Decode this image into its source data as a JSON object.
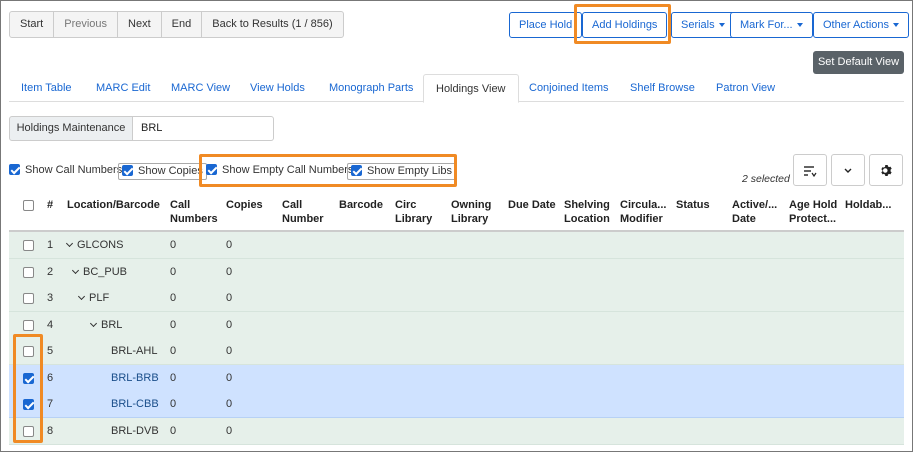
{
  "nav": {
    "start": "Start",
    "previous": "Previous",
    "next": "Next",
    "end": "End",
    "back": "Back to Results (1 / 856)"
  },
  "actions": {
    "place_hold": "Place Hold",
    "add_holdings": "Add Holdings",
    "serials": "Serials",
    "mark_for": "Mark For...",
    "other_actions": "Other Actions",
    "set_default_view": "Set Default View"
  },
  "tabs": [
    {
      "label": "Item Table"
    },
    {
      "label": "MARC Edit"
    },
    {
      "label": "MARC View"
    },
    {
      "label": "View Holds"
    },
    {
      "label": "Monograph Parts"
    },
    {
      "label": "Holdings View",
      "active": true
    },
    {
      "label": "Conjoined Items"
    },
    {
      "label": "Shelf Browse"
    },
    {
      "label": "Patron View"
    }
  ],
  "holdings": {
    "label": "Holdings Maintenance",
    "value": "BRL"
  },
  "options": {
    "show_call_numbers": {
      "label": "Show Call Numbers",
      "checked": true
    },
    "show_copies": {
      "label": "Show Copies",
      "checked": true
    },
    "show_empty_call_numbers": {
      "label": "Show Empty Call Numbers",
      "checked": true
    },
    "show_empty_libs": {
      "label": "Show Empty Libs",
      "checked": true
    }
  },
  "selection": {
    "count_label": "2 selected"
  },
  "toolbar_icons": [
    "sort-lines-icon",
    "chevron-down-icon",
    "gear-icon"
  ],
  "columns": {
    "num": "#",
    "location": "Location/Barcode",
    "call_numbers_1": "Call",
    "call_numbers_2": "Numbers",
    "copies": "Copies",
    "call_number_1": "Call",
    "call_number_2": "Number",
    "barcode": "Barcode",
    "circ_library_1": "Circ",
    "circ_library_2": "Library",
    "owning_library_1": "Owning",
    "owning_library_2": "Library",
    "due_date": "Due Date",
    "shelving_1": "Shelving",
    "shelving_2": "Location",
    "circ_mod_1": "Circula...",
    "circ_mod_2": "Modifier",
    "status": "Status",
    "active_1": "Active/...",
    "active_2": "Date",
    "age_hold_1": "Age Hold",
    "age_hold_2": "Protect...",
    "holdable": "Holdab..."
  },
  "rows": [
    {
      "num": "1",
      "location": "GLCONS",
      "call_numbers": "0",
      "copies": "0",
      "checked": false,
      "link": false
    },
    {
      "num": "2",
      "location": "BC_PUB",
      "call_numbers": "0",
      "copies": "0",
      "checked": false,
      "link": false
    },
    {
      "num": "3",
      "location": "PLF",
      "call_numbers": "0",
      "copies": "0",
      "checked": false,
      "link": false
    },
    {
      "num": "4",
      "location": "BRL",
      "call_numbers": "0",
      "copies": "0",
      "checked": false,
      "link": false
    },
    {
      "num": "5",
      "location": "BRL-AHL",
      "call_numbers": "0",
      "copies": "0",
      "checked": false,
      "link": false
    },
    {
      "num": "6",
      "location": "BRL-BRB",
      "call_numbers": "0",
      "copies": "0",
      "checked": true,
      "link": true
    },
    {
      "num": "7",
      "location": "BRL-CBB",
      "call_numbers": "0",
      "copies": "0",
      "checked": true,
      "link": true
    },
    {
      "num": "8",
      "location": "BRL-DVB",
      "call_numbers": "0",
      "copies": "0",
      "checked": false,
      "link": false
    }
  ],
  "colors": {
    "highlight": "#f08a24",
    "primary": "#1967d2",
    "row_bg": "#e6f0ea",
    "row_selected_bg": "#cfe2ff"
  }
}
